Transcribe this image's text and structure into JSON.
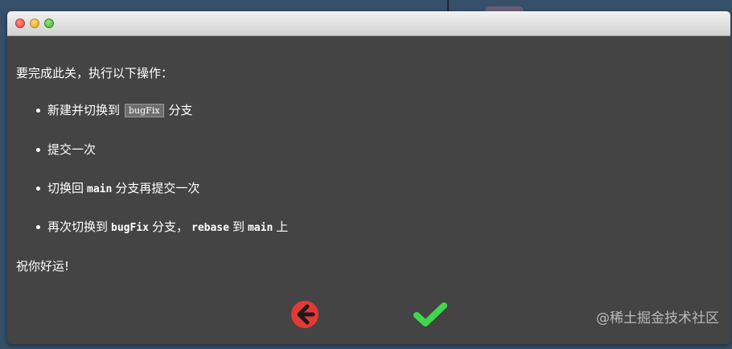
{
  "dialog": {
    "intro": "要完成此关，执行以下操作：",
    "steps": {
      "s1": {
        "pre": "新建并切换到",
        "code": "bugFix",
        "post": "分支"
      },
      "s2": {
        "text": "提交一次"
      },
      "s3": {
        "pre": "切换回",
        "code": "main",
        "post": "分支再提交一次"
      },
      "s4": {
        "pre": "再次切换到",
        "code1": "bugFix",
        "mid": "分支，",
        "code2": "rebase",
        "mid2": "到",
        "code3": "main",
        "post": "上"
      }
    },
    "outro": "祝你好运!",
    "back_icon": "back-arrow-icon",
    "confirm_icon": "checkmark-icon"
  },
  "watermark": "@稀土掘金技术社区",
  "colors": {
    "panel_bg": "#444444",
    "back_button": "#e53935",
    "confirm_button": "#3ed84a"
  }
}
